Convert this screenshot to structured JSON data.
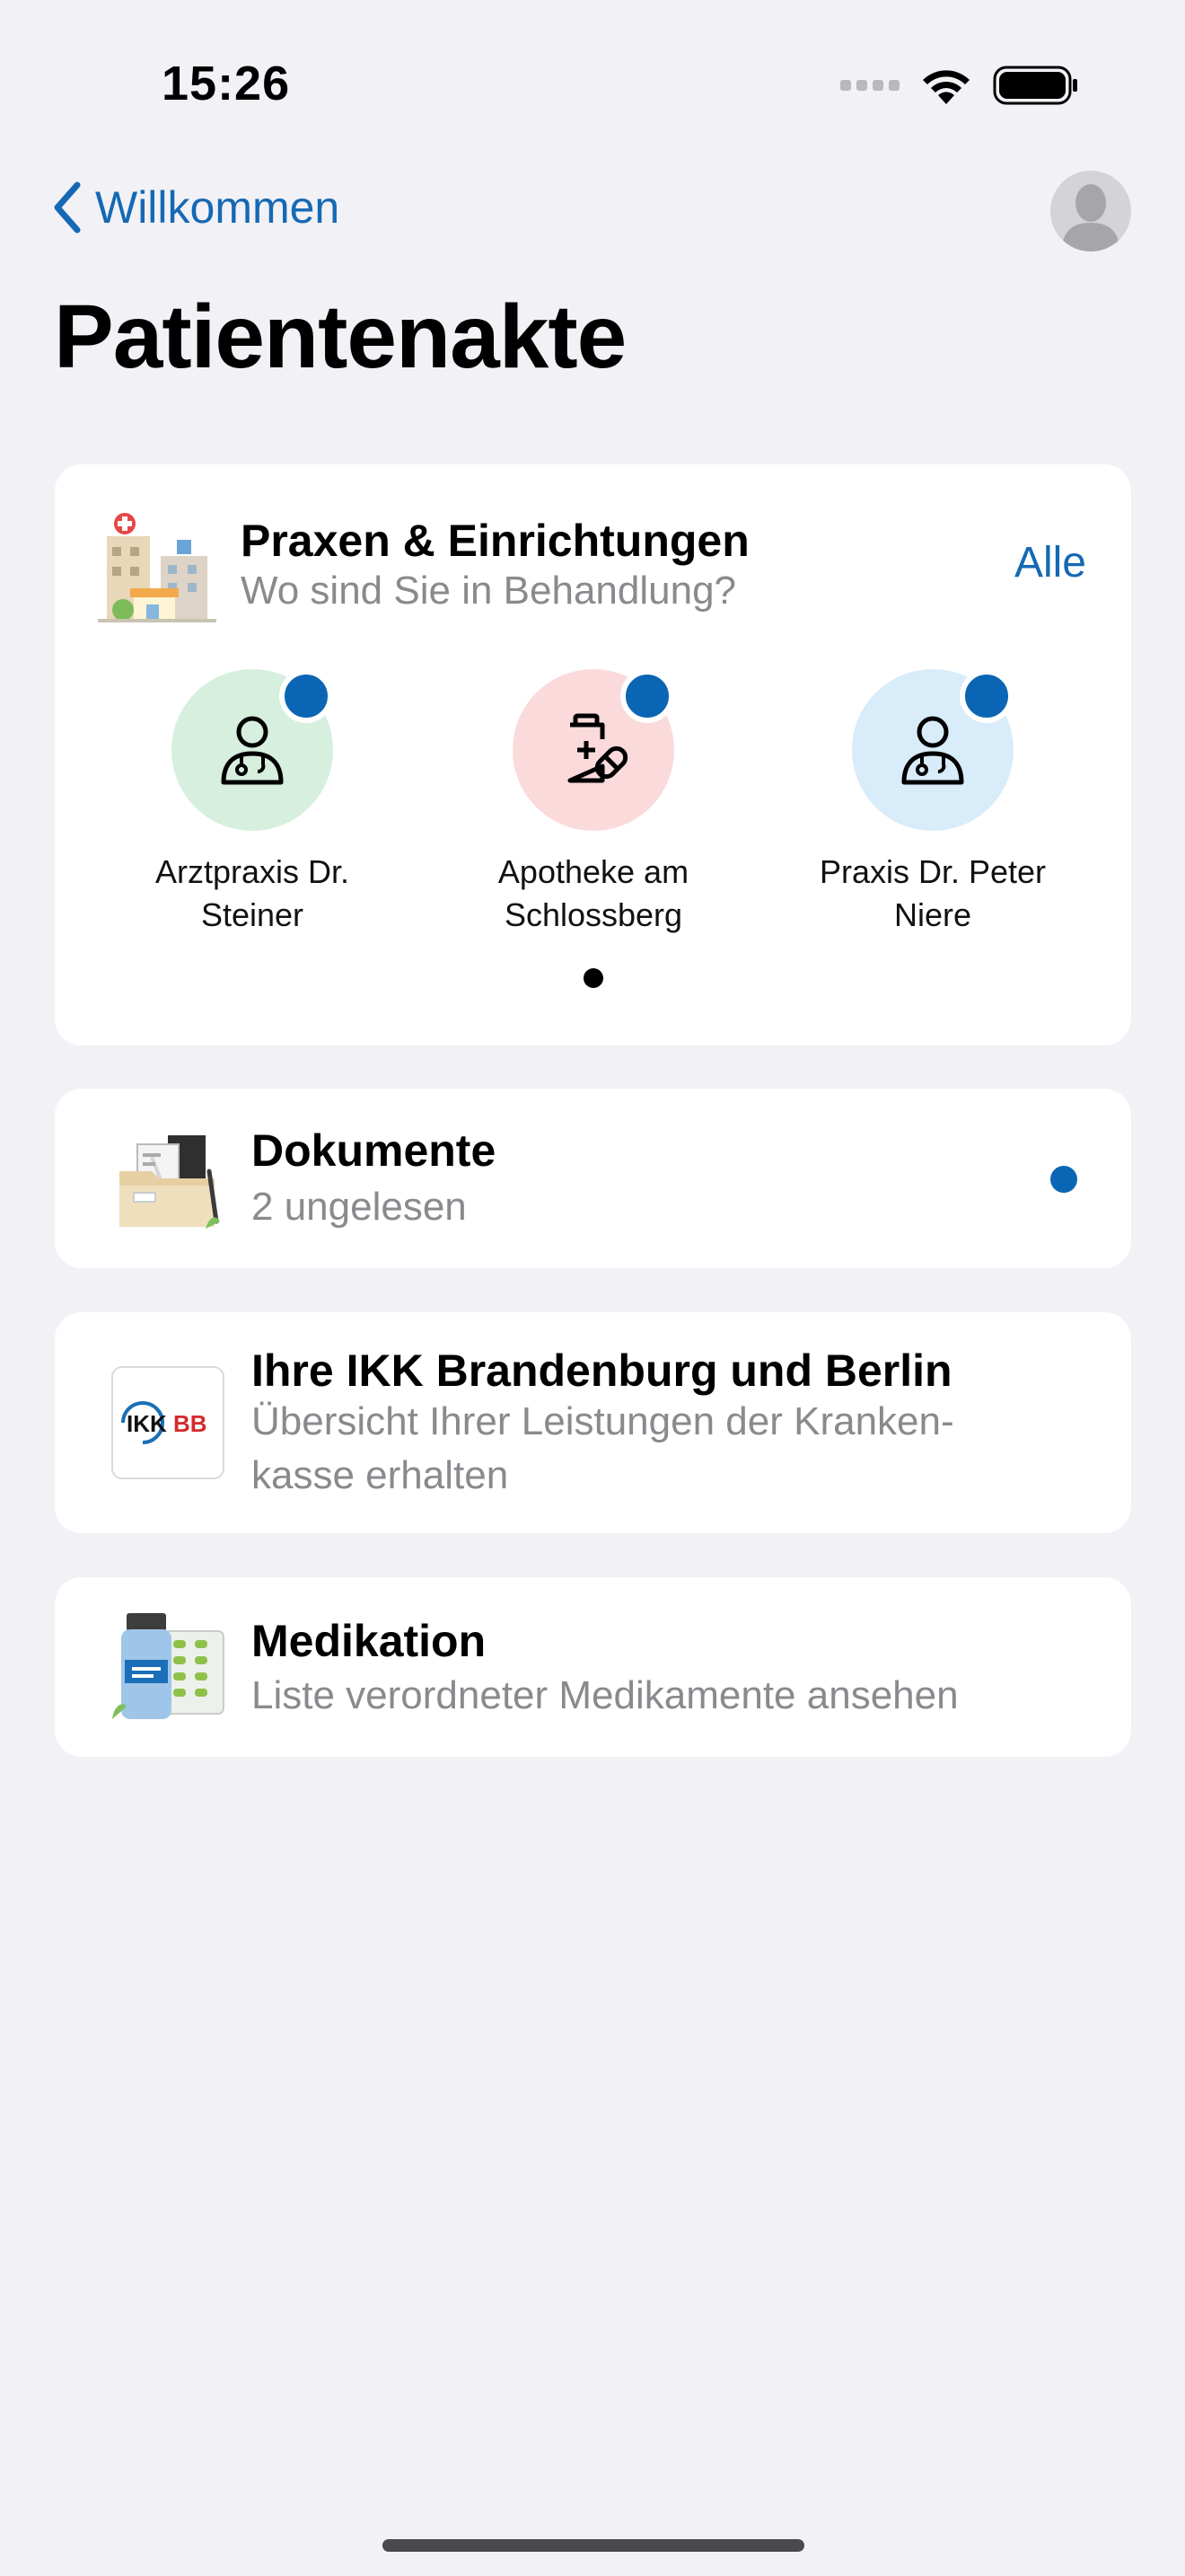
{
  "status_bar": {
    "time": "15:26"
  },
  "nav": {
    "back_label": "Willkommen"
  },
  "page": {
    "title": "Patientenakte"
  },
  "praxen": {
    "title": "Praxen & Einrichtungen",
    "subtitle": "Wo sind Sie in Behandlung?",
    "all_label": "Alle",
    "items": [
      {
        "name": "Arztpraxis Dr. Steiner",
        "circle_color": "#d6efde",
        "icon": "doctor-icon"
      },
      {
        "name": "Apotheke am Schlossberg",
        "circle_color": "#fadadb",
        "icon": "pharmacy-icon"
      },
      {
        "name": "Praxis Dr. Peter Niere",
        "circle_color": "#d8ecfa",
        "icon": "doctor-icon"
      }
    ]
  },
  "documents": {
    "title": "Dokumente",
    "subtitle": "2 ungelesen"
  },
  "insurance": {
    "title": "Ihre IKK Brandenburg und Berlin",
    "subtitle_line1": "Übersicht Ihrer Leistungen der Kranken-",
    "subtitle_line2": "kasse erhalten",
    "logo_text": "IKKBB"
  },
  "medication": {
    "title": "Medikation",
    "subtitle": "Liste verordneter Medikamente ansehen"
  },
  "colors": {
    "accent": "#1569b4",
    "badge": "#0a66b4",
    "background": "#f2f1f6"
  }
}
